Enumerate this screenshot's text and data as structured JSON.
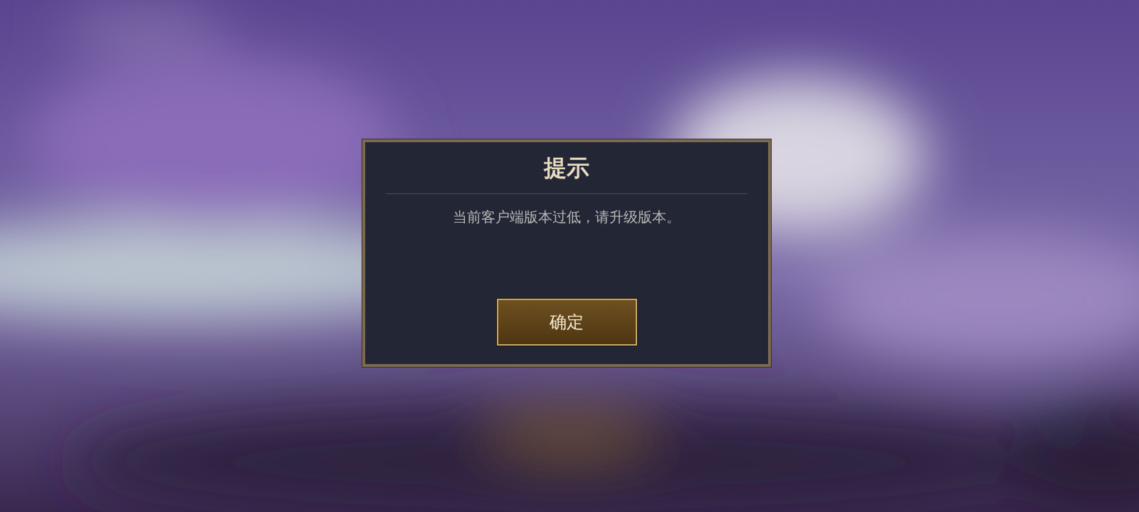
{
  "dialog": {
    "title": "提示",
    "message": "当前客户端版本过低，请升级版本。",
    "buttons": [
      {
        "label": "确定"
      }
    ]
  }
}
